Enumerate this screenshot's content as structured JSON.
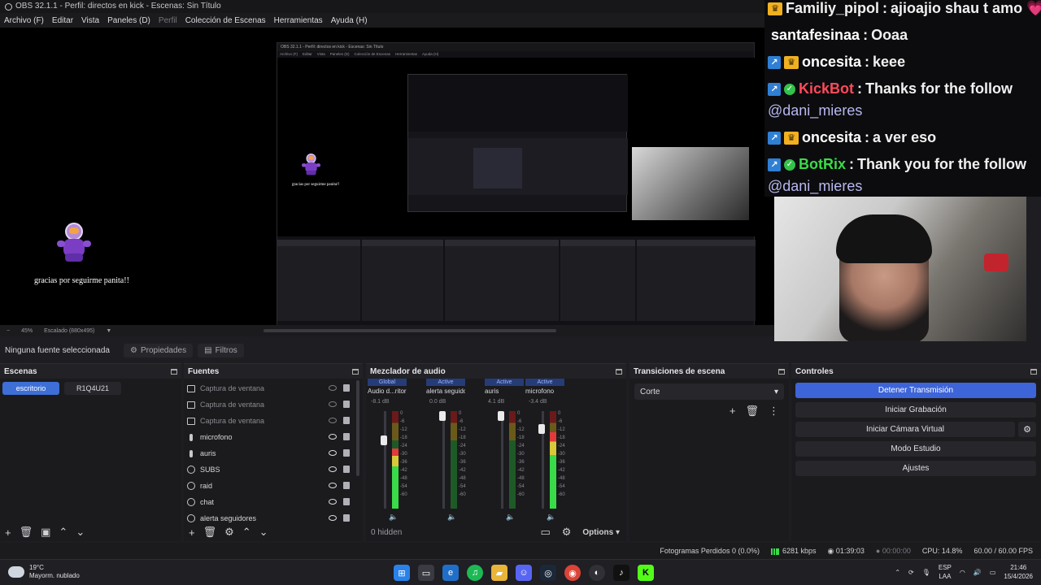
{
  "window": {
    "title": "OBS 32.1.1 - Perfil: directos en kick - Escenas: Sin Título"
  },
  "menu": {
    "items": [
      "Archivo (F)",
      "Editar",
      "Vista",
      "Paneles (D)",
      "Perfil",
      "Colección de Escenas",
      "Herramientas",
      "Ayuda (H)"
    ]
  },
  "preview": {
    "follow_text": "gracias por seguirme panita!!",
    "zoom": "45%",
    "scaling": "Escalado (880x495)"
  },
  "chat": {
    "lines": [
      {
        "user": "Familiy_pipol",
        "sep": " : ",
        "message": "ajioajio shau t amo 💗",
        "user_color": "#f0f0f0"
      },
      {
        "user": "santafesinaa",
        "sep": " : ",
        "message": "Ooaa",
        "user_color": "#f0f0f0"
      },
      {
        "user": "oncesita",
        "sep": " : ",
        "message": "keee",
        "user_color": "#f0f0f0"
      },
      {
        "user": "KickBot",
        "sep": " : ",
        "message": "Thanks for the follow",
        "user_color": "#ff4a5a"
      },
      {
        "mention": "@dani_mieres"
      },
      {
        "user": "oncesita",
        "sep": " : ",
        "message": "a ver eso",
        "user_color": "#f0f0f0"
      },
      {
        "user": "BotRix",
        "sep": " : ",
        "message": "Thank you for the follow",
        "user_color": "#3adb48"
      },
      {
        "mention": "@dani_mieres"
      }
    ]
  },
  "source_toolbar": {
    "no_selection": "Ninguna fuente seleccionada",
    "properties": "Propiedades",
    "filters": "Filtros"
  },
  "scenes": {
    "title": "Escenas",
    "items": [
      {
        "label": "escritorio",
        "active": true
      },
      {
        "label": "R1Q4U21",
        "active": false
      }
    ]
  },
  "sources": {
    "title": "Fuentes",
    "items": [
      {
        "label": "Captura de ventana",
        "type": "window",
        "visible": false
      },
      {
        "label": "Captura de ventana",
        "type": "window",
        "visible": false
      },
      {
        "label": "Captura de ventana",
        "type": "window",
        "visible": false
      },
      {
        "label": "microfono",
        "type": "mic",
        "visible": true
      },
      {
        "label": "auris",
        "type": "mic",
        "visible": true
      },
      {
        "label": "SUBS",
        "type": "browser",
        "visible": true
      },
      {
        "label": "raid",
        "type": "browser",
        "visible": true
      },
      {
        "label": "chat",
        "type": "browser",
        "visible": true
      },
      {
        "label": "alerta seguidores",
        "type": "browser",
        "visible": true
      }
    ]
  },
  "mixer": {
    "title": "Mezclador de audio",
    "channels": [
      {
        "tag": "Global",
        "name": "Audio d...ritorio",
        "db": "-8.1 dB",
        "fader": 0.72,
        "level": 0.62
      },
      {
        "tag": "Active",
        "name": "alerta seguidores",
        "db": "0.0 dB",
        "fader": 1.0,
        "level": 0.0
      },
      {
        "tag": "Active",
        "name": "auris",
        "db": "4.1 dB",
        "fader": 1.0,
        "level": 0.0
      },
      {
        "tag": "Active",
        "name": "microfono",
        "db": "-3.4 dB",
        "fader": 0.85,
        "level": 0.78
      }
    ],
    "scale": [
      "0",
      "-6",
      "-12",
      "-18",
      "-24",
      "-30",
      "-36",
      "-42",
      "-48",
      "-54",
      "-60"
    ],
    "hidden": "0 hidden",
    "options": "Options"
  },
  "transitions": {
    "title": "Transiciones de escena",
    "selected": "Corte"
  },
  "controls": {
    "title": "Controles",
    "stop_stream": "Detener Transmisión",
    "start_recording": "Iniciar Grabación",
    "start_virtual_cam": "Iniciar Cámara Virtual",
    "studio_mode": "Modo Estudio",
    "settings": "Ajustes"
  },
  "status": {
    "dropped": "Fotogramas Perdidos 0 (0.0%)",
    "bitrate": "6281 kbps",
    "stream_time": "01:39:03",
    "rec_time": "00:00:00",
    "cpu": "CPU: 14.8%",
    "fps": "60.00 / 60.00 FPS"
  },
  "taskbar": {
    "temp": "19°C",
    "weather": "Mayorm. nublado",
    "lang_top": "ESP",
    "lang_bottom": "LAA",
    "time": "21:46",
    "date": "15/4/2026"
  }
}
